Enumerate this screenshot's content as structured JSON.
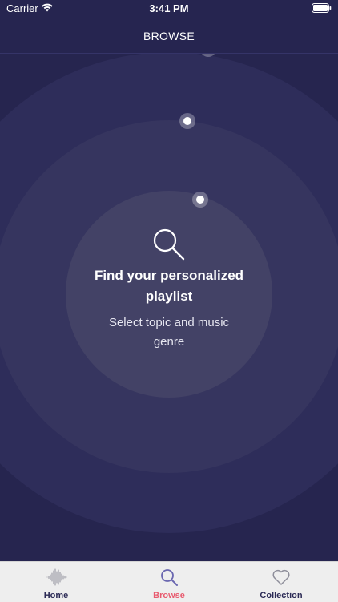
{
  "status_bar": {
    "carrier": "Carrier",
    "time": "3:41 PM"
  },
  "nav": {
    "title": "BROWSE"
  },
  "browse": {
    "title": "Find your personalized playlist",
    "subtitle": "Select topic and music genre",
    "search_icon": "search-icon"
  },
  "tabs": [
    {
      "label": "Home",
      "icon": "waveform-icon",
      "selected": false
    },
    {
      "label": "Browse",
      "icon": "search-icon",
      "selected": true
    },
    {
      "label": "Collection",
      "icon": "heart-icon",
      "selected": false
    }
  ],
  "colors": {
    "background": "#26254f",
    "accent": "#e85a6e",
    "tab_text": "#2b2a55"
  }
}
